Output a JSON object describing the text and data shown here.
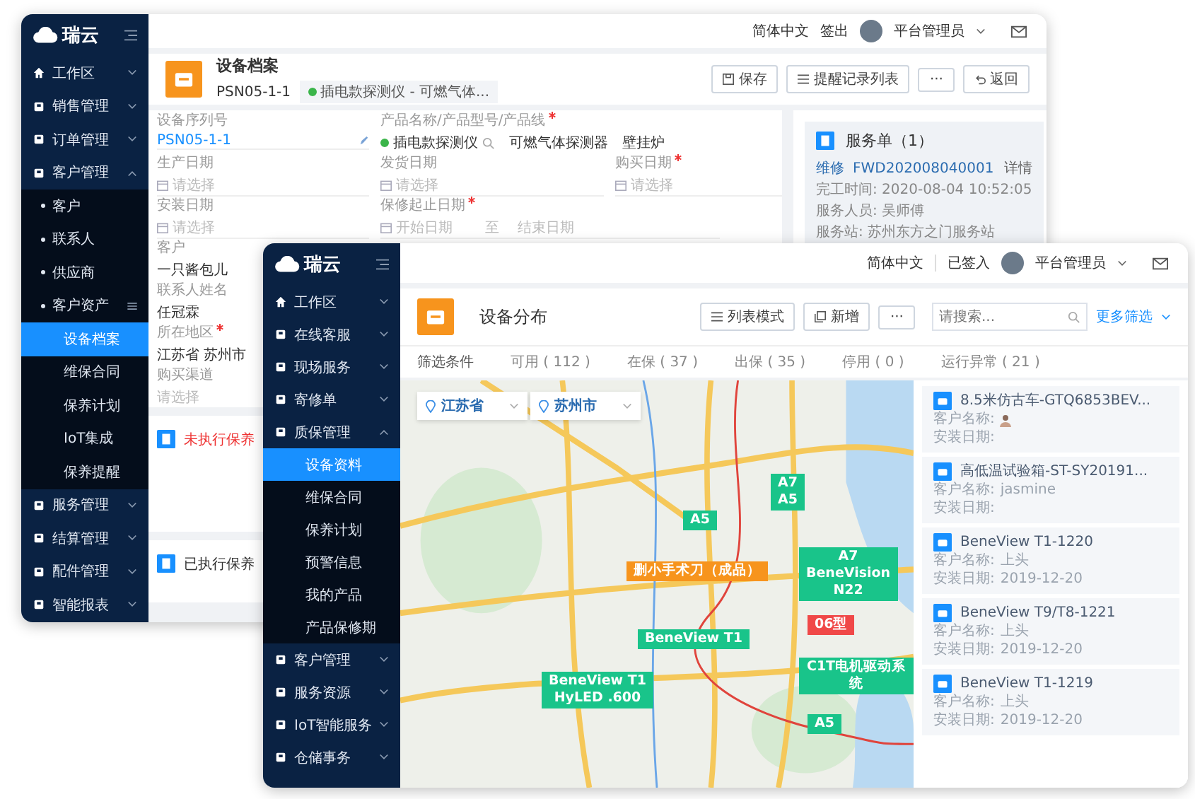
{
  "back_window": {
    "sidebar": {
      "logo": "瑞云",
      "items": [
        {
          "label": "工作区",
          "expanded": false,
          "selected": false
        },
        {
          "label": "销售管理",
          "expanded": false,
          "selected": false
        },
        {
          "label": "订单管理",
          "expanded": false,
          "selected": false
        },
        {
          "label": "客户管理",
          "expanded": true,
          "selected": false,
          "children": [
            {
              "label": "客户",
              "selected": false
            },
            {
              "label": "联系人",
              "selected": false
            },
            {
              "label": "供应商",
              "selected": false
            },
            {
              "label": "客户资产",
              "expanded": true,
              "selected": false,
              "children": [
                {
                  "label": "设备档案",
                  "selected": true
                },
                {
                  "label": "维保合同",
                  "selected": false
                },
                {
                  "label": "保养计划",
                  "selected": false
                },
                {
                  "label": "IoT集成",
                  "selected": false
                },
                {
                  "label": "保养提醒",
                  "selected": false
                }
              ]
            }
          ]
        },
        {
          "label": "服务管理",
          "expanded": false,
          "selected": false
        },
        {
          "label": "结算管理",
          "expanded": false,
          "selected": false
        },
        {
          "label": "配件管理",
          "expanded": false,
          "selected": false
        },
        {
          "label": "智能报表",
          "expanded": false,
          "selected": false
        }
      ]
    },
    "header": {
      "language": "简体中文",
      "sign": "签出",
      "user": "平台管理员"
    },
    "page": {
      "title": "设备档案",
      "subtitle": "PSN05-1-1",
      "tag": "插电款探测仪 - 可燃气体...",
      "buttons": [
        "保存",
        "提醒记录列表",
        "···",
        "返回"
      ]
    },
    "form": {
      "rows": [
        [
          {
            "kind": "link",
            "label": "设备序列号",
            "required": false,
            "value": "PSN05-1-1"
          },
          {
            "kind": "product",
            "label": "产品名称/产品型号/产品线",
            "required": true,
            "values": [
              "插电款探测仪",
              "可燃气体探测器",
              "壁挂炉"
            ]
          }
        ],
        [
          {
            "kind": "date",
            "label": "生产日期",
            "required": false,
            "placeholder": "请选择"
          },
          {
            "kind": "date",
            "label": "发货日期",
            "required": false,
            "placeholder": "请选择"
          },
          {
            "kind": "date",
            "label": "购买日期",
            "required": true,
            "placeholder": "请选择"
          }
        ],
        [
          {
            "kind": "date",
            "label": "安装日期",
            "required": false,
            "placeholder": "请选择"
          },
          {
            "kind": "daterange",
            "label": "保修起止日期",
            "required": true,
            "placeholder": "开始日期",
            "separator": "至",
            "placeholder_end": "结束日期"
          }
        ],
        [
          {
            "kind": "text",
            "label": "客户",
            "required": false,
            "value": "一只酱包儿"
          }
        ],
        [
          {
            "kind": "text",
            "label": "联系人姓名",
            "required": false,
            "value": "任冠霖"
          }
        ],
        [
          {
            "kind": "text",
            "label": "所在地区",
            "required": true,
            "value": "江苏省 苏州市"
          }
        ],
        [
          {
            "kind": "select",
            "label": "购买渠道",
            "required": false,
            "placeholder": "请选择"
          }
        ]
      ]
    },
    "sections": [
      {
        "title": "未执行保养",
        "highlighted": true
      },
      {
        "title": "已执行保养",
        "highlighted": false
      }
    ],
    "service": {
      "title": "服务单（1）",
      "type": "维修",
      "number": "FWD202008040001",
      "action": "详情",
      "lines": [
        "完工时间:  2020-08-04 10:52:05",
        "服务人员:  吴师傅",
        "服务站:  苏州东方之门服务站"
      ]
    }
  },
  "front_window": {
    "sidebar": {
      "logo": "瑞云",
      "items": [
        {
          "label": "工作区",
          "expanded": false,
          "selected": false
        },
        {
          "label": "在线客服",
          "expanded": false,
          "selected": false
        },
        {
          "label": "现场服务",
          "expanded": false,
          "selected": false
        },
        {
          "label": "寄修单",
          "expanded": false,
          "selected": false
        },
        {
          "label": "质保管理",
          "expanded": true,
          "selected": false,
          "children": [
            {
              "label": "设备资料",
              "selected": true
            },
            {
              "label": "维保合同",
              "selected": false
            },
            {
              "label": "保养计划",
              "selected": false
            },
            {
              "label": "预警信息",
              "selected": false
            },
            {
              "label": "我的产品",
              "selected": false
            },
            {
              "label": "产品保修期",
              "selected": false
            }
          ]
        },
        {
          "label": "客户管理",
          "expanded": false,
          "selected": false
        },
        {
          "label": "服务资源",
          "expanded": false,
          "selected": false
        },
        {
          "label": "IoT智能服务",
          "expanded": false,
          "selected": false
        },
        {
          "label": "仓储事务",
          "expanded": false,
          "selected": false
        }
      ]
    },
    "header": {
      "language": "简体中文",
      "sign": "已签入",
      "user": "平台管理员"
    },
    "page": {
      "title": "设备分布",
      "buttons": [
        "列表模式",
        "新增",
        "···"
      ],
      "search": {
        "placeholder": "请搜索..."
      },
      "more_filters": "更多筛选"
    },
    "filters": {
      "label": "筛选条件",
      "items": [
        "可用 ( 112 )",
        "在保 ( 37 )",
        "出保 ( 35 )",
        "停用 ( 0 )",
        "运行异常 ( 21 )"
      ]
    },
    "map": {
      "province": "江苏省",
      "city": "苏州市",
      "markers": [
        {
          "lines": [
            "A5"
          ],
          "color": "#19c48a"
        },
        {
          "lines": [
            "A7",
            "A5"
          ],
          "color": "#19c48a"
        },
        {
          "lines": [
            "删小手术刀（成品）"
          ],
          "color": "#f7941d"
        },
        {
          "lines": [
            "A7",
            "BeneVision",
            "N22"
          ],
          "color": "#19c48a"
        },
        {
          "lines": [
            "06型"
          ],
          "color": "#f04848"
        },
        {
          "lines": [
            "BeneView T1"
          ],
          "color": "#19c48a"
        },
        {
          "lines": [
            "BeneView T1",
            "HyLED .600"
          ],
          "color": "#19c48a"
        },
        {
          "lines": [
            "C1T电机驱动系统"
          ],
          "color": "#19c48a"
        },
        {
          "lines": [
            "A5"
          ],
          "color": "#19c48a"
        }
      ]
    },
    "devices": [
      {
        "title": "8.5米仿古车-GTQ6853BEV...",
        "customer_label": "客户名称:",
        "avatar": true,
        "date_label": "安装日期:"
      },
      {
        "title": "高低温试验箱-ST-SY20191...",
        "customer_label": "客户名称:",
        "customer": "jasmine",
        "avatar": false,
        "date_label": "安装日期:"
      },
      {
        "title": "BeneView T1-1220",
        "customer_label": "客户名称:",
        "customer": "上头",
        "avatar": false,
        "date_label": "安装日期:",
        "date": "2019-12-20"
      },
      {
        "title": "BeneView T9/T8-1221",
        "customer_label": "客户名称:",
        "customer": "上头",
        "avatar": false,
        "date_label": "安装日期:",
        "date": "2019-12-20"
      },
      {
        "title": "BeneView T1-1219",
        "customer_label": "客户名称:",
        "customer": "上头",
        "avatar": false,
        "date_label": "安装日期:",
        "date": "2019-12-20"
      }
    ]
  }
}
